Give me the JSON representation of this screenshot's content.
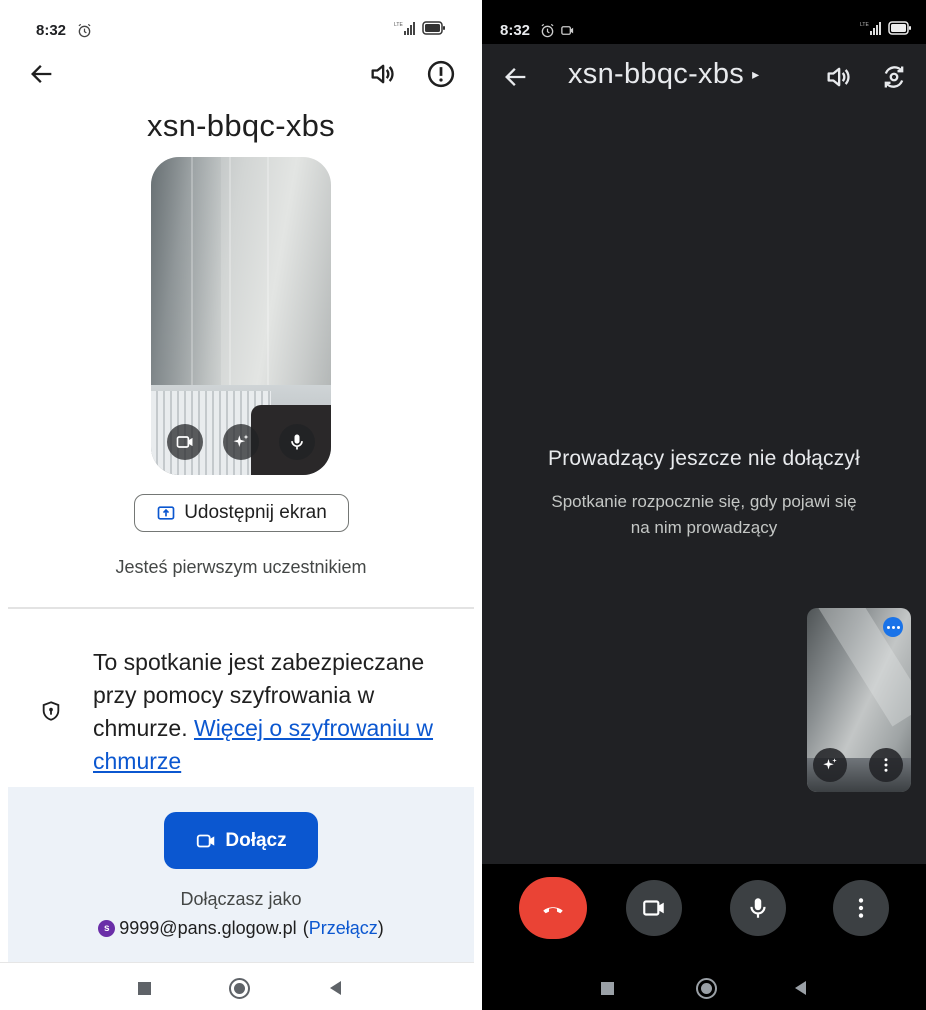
{
  "left": {
    "status_bar": {
      "time": "8:32",
      "alarm_icon": "alarm-clock-icon",
      "signal_icon": "lte-signal-icon",
      "battery_icon": "battery-icon"
    },
    "app_bar": {
      "back_icon": "arrow-back-icon",
      "volume_icon": "volume-icon",
      "report_icon": "report-problem-icon"
    },
    "meeting_code": "xsn-bbqc-xbs",
    "preview_controls": [
      "camera-icon",
      "effects-sparkle-icon",
      "microphone-icon"
    ],
    "share_screen_label": "Udostępnij ekran",
    "first_participant_text": "Jesteś pierwszym uczestnikiem",
    "encryption": {
      "text": "To spotkanie jest zabezpieczane przy pomocy szyfrowania w chmurze. ",
      "link": "Więcej o szyfrowaniu w chmurze"
    },
    "join_button_label": "Dołącz",
    "joining_as_label": "Dołączasz jako",
    "account": {
      "avatar_letter": "s",
      "email": "9999@pans.glogow.pl",
      "open_paren": "(",
      "switch_label": "Przełącz",
      "close_paren": ")"
    }
  },
  "right": {
    "status_bar": {
      "time": "8:32",
      "alarm_icon": "alarm-clock-icon",
      "cast_icon": "screen-record-icon",
      "signal_icon": "lte-signal-icon",
      "battery_icon": "battery-icon"
    },
    "meeting_code": "xsn-bbqc-xbs",
    "title_caret": "▸",
    "host_heading": "Prowadzący jeszcze nie dołączył",
    "host_subtext": "Spotkanie rozpocznie się, gdy pojawi się na nim prowadzący",
    "self_tile_controls": [
      "effects-sparkle-icon",
      "more-vert-icon"
    ],
    "controls": [
      "end-call-icon",
      "camera-icon",
      "microphone-icon",
      "more-vert-icon"
    ]
  },
  "colors": {
    "primary_blue": "#0b57d0",
    "end_call_red": "#ea4335",
    "dark_surface": "#202124",
    "join_area_bg": "#edf2f8"
  }
}
